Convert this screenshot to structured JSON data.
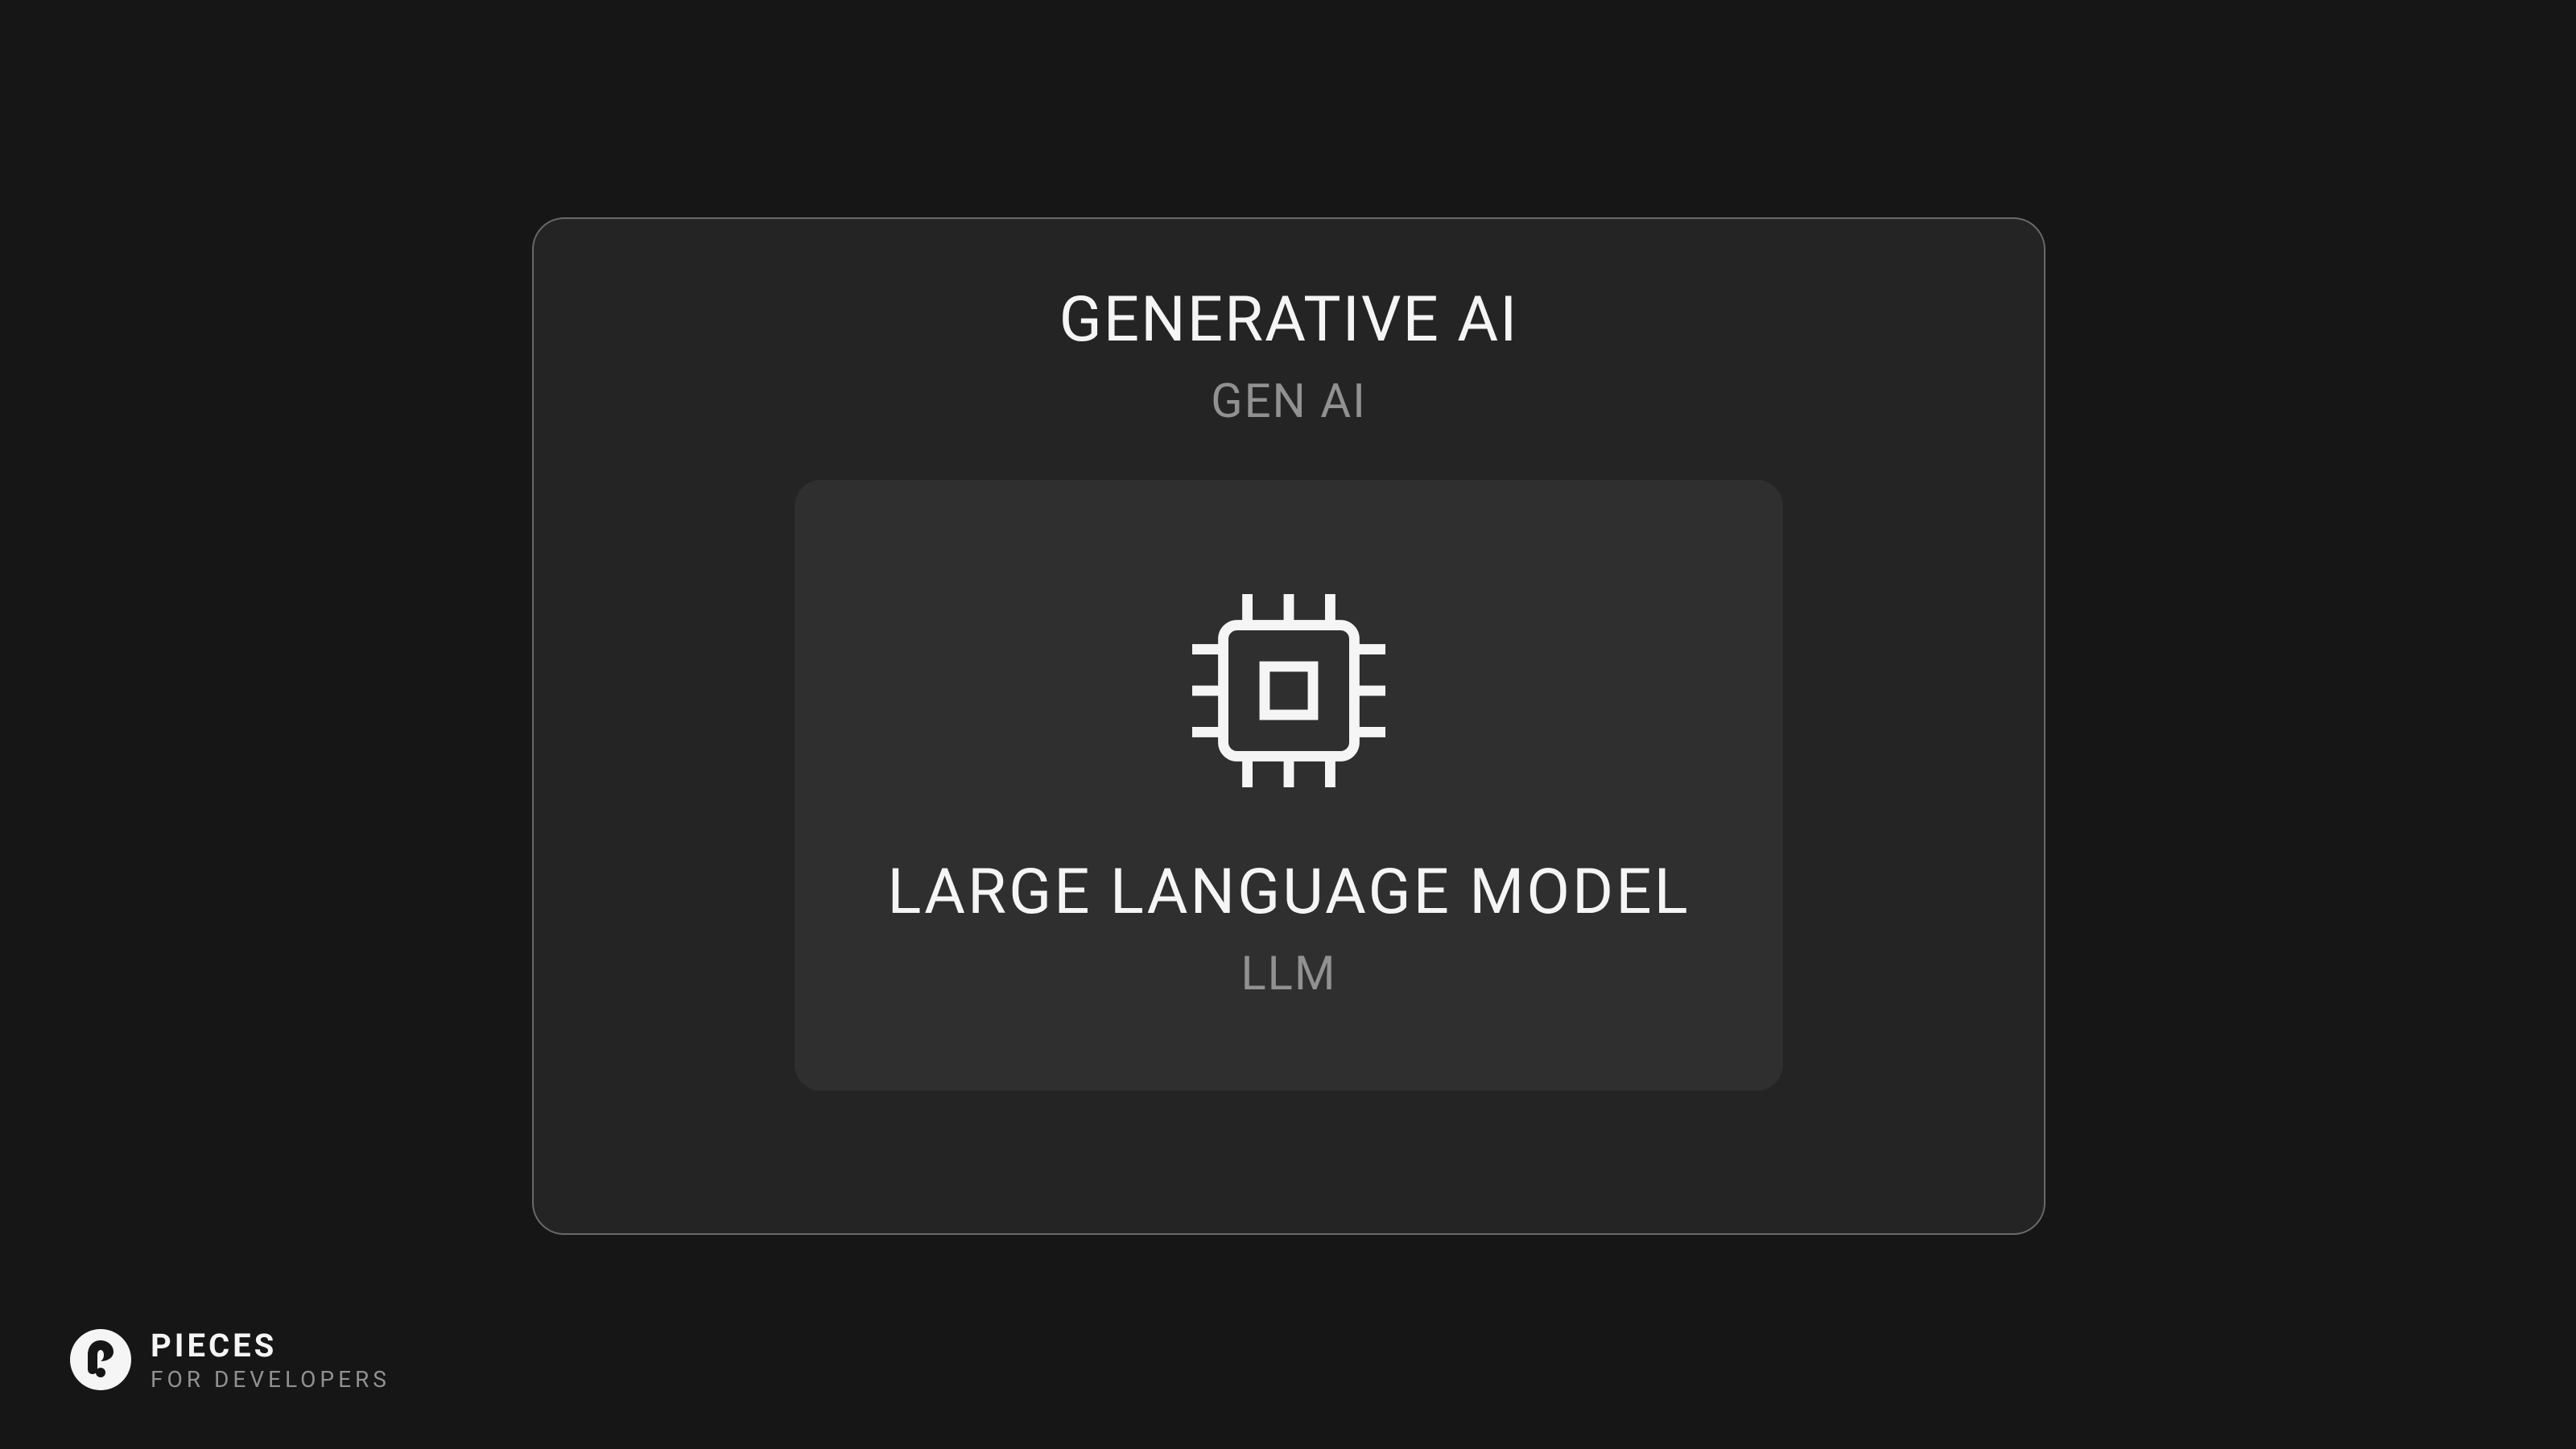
{
  "outer": {
    "title": "GENERATIVE AI",
    "subtitle": "GEN AI"
  },
  "inner": {
    "title": "LARGE LANGUAGE MODEL",
    "subtitle": "LLM",
    "icon": "chip-icon"
  },
  "brand": {
    "label": "PIECES",
    "sublabel": "FOR DEVELOPERS"
  },
  "colors": {
    "background": "#161616",
    "outer_box_bg": "#242424",
    "outer_box_border": "#6a6a6a",
    "inner_box_bg": "#2f2f2f",
    "text_primary": "#f5f5f5",
    "text_secondary": "#919191",
    "gradient_start": "#9c4dff",
    "gradient_mid1": "#d89a3a",
    "gradient_mid2": "#e8c54a",
    "gradient_end": "#2dd4bf"
  }
}
